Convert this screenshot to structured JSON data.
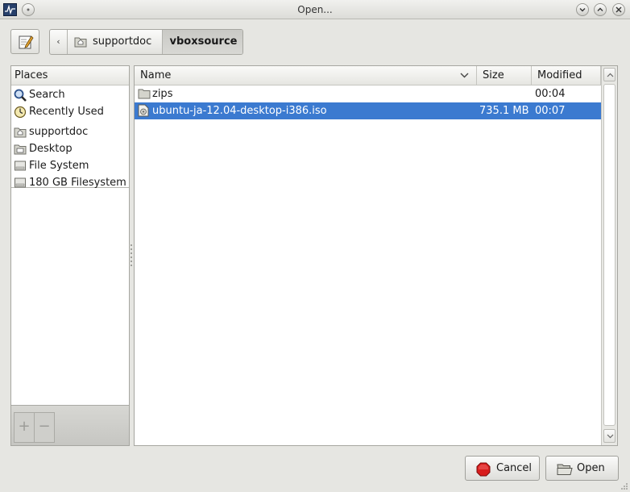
{
  "window": {
    "title": "Open..."
  },
  "toolbar": {
    "back_symbol": "‹"
  },
  "breadcrumbs": [
    {
      "label": "supportdoc",
      "icon": "home-folder-icon"
    },
    {
      "label": "vboxsource",
      "current": true
    }
  ],
  "places": {
    "header": "Places",
    "items": [
      {
        "label": "Search",
        "icon": "search-icon"
      },
      {
        "label": "Recently Used",
        "icon": "clock-icon"
      },
      {
        "label": "supportdoc",
        "icon": "home-folder-icon"
      },
      {
        "label": "Desktop",
        "icon": "desktop-folder-icon"
      },
      {
        "label": "File System",
        "icon": "drive-icon"
      },
      {
        "label": "180 GB Filesystem",
        "icon": "drive-icon"
      }
    ],
    "add_symbol": "+",
    "remove_symbol": "−"
  },
  "file_list": {
    "columns": {
      "name": "Name",
      "size": "Size",
      "modified": "Modified"
    },
    "rows": [
      {
        "name": "zips",
        "size": "",
        "modified": "00:04",
        "icon": "folder-icon",
        "selected": false
      },
      {
        "name": "ubuntu-ja-12.04-desktop-i386.iso",
        "size": "735.1 MB",
        "modified": "00:07",
        "icon": "disc-image-icon",
        "selected": true
      }
    ]
  },
  "actions": {
    "cancel_label": "Cancel",
    "open_label": "Open"
  },
  "colors": {
    "selection": "#3b7ad0",
    "window_bg": "#e6e6e2"
  }
}
